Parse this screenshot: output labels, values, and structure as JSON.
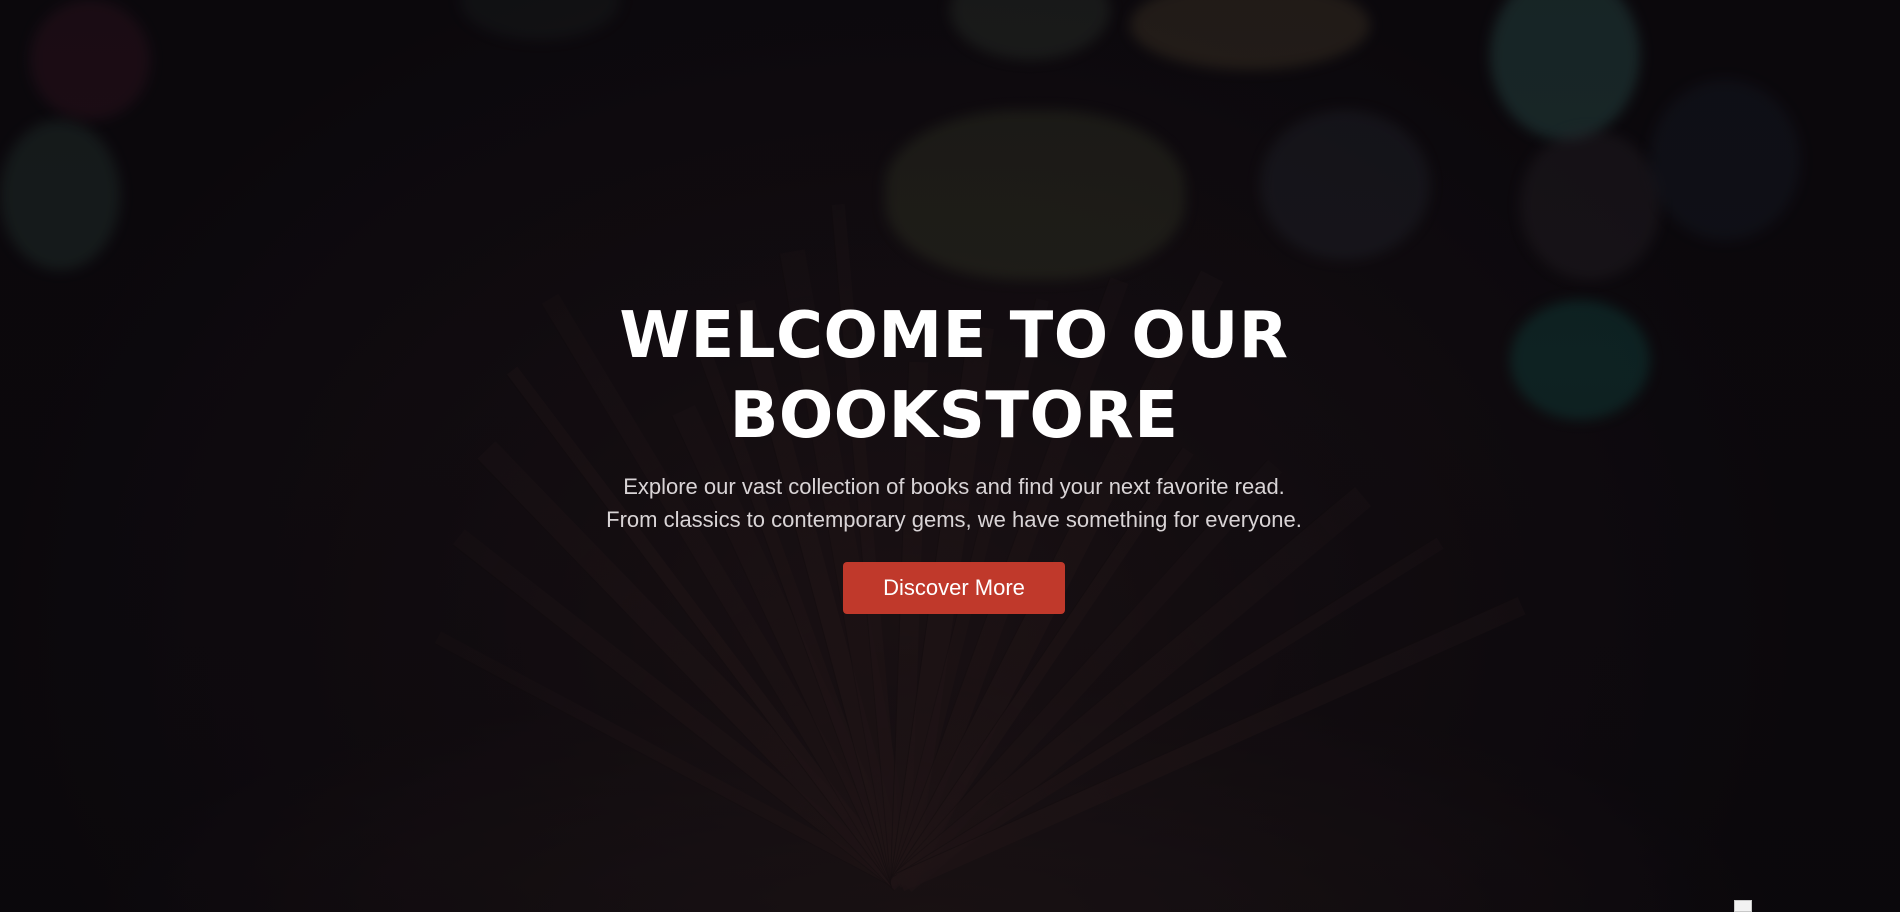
{
  "hero": {
    "title_line1": "WELCOME TO OUR",
    "title_line2": "BOOKSTORE",
    "subtitle_line1": "Explore our vast collection of books and find your next favorite read.",
    "subtitle_line2": "From classics to contemporary gems, we have something for everyone.",
    "cta_label": "Discover More"
  },
  "colors": {
    "accent": "#c0392b",
    "text_primary": "#ffffff",
    "text_secondary": "#d9d4d6",
    "background": "#120d12"
  },
  "icons": {
    "broken_image": "broken-image-icon"
  }
}
